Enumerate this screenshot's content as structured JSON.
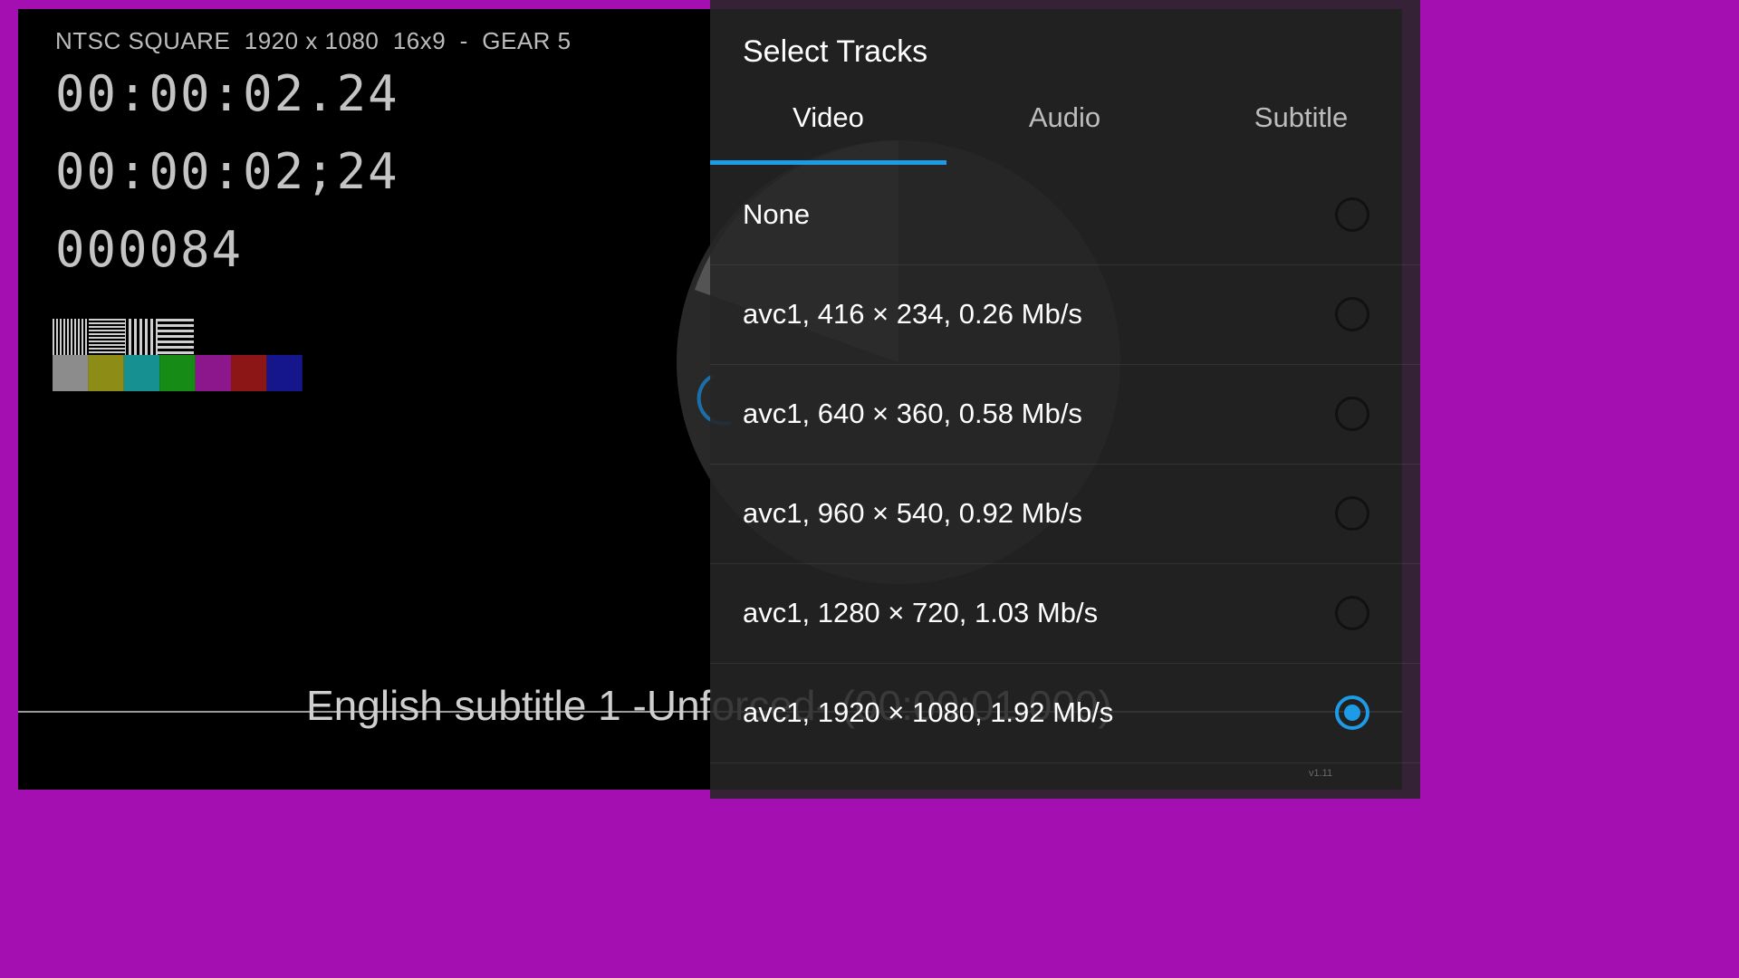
{
  "video": {
    "info_line": "NTSC SQUARE  1920 x 1080  16x9  -  GEAR 5",
    "timecodes": [
      "00:00:02.24",
      "00:00:02;24",
      "000084"
    ],
    "subtitle_text": "English subtitle 1 -Unforced- (00:00:01.000)",
    "color_bars": [
      "#8c8c8c",
      "#8c8c16",
      "#169090",
      "#168c16",
      "#8c168c",
      "#8c1616",
      "#16168c"
    ]
  },
  "dialog": {
    "title": "Select Tracks",
    "tabs": [
      {
        "label": "Video",
        "selected": true
      },
      {
        "label": "Audio",
        "selected": false
      },
      {
        "label": "Subtitle",
        "selected": false
      }
    ],
    "tracks": [
      {
        "label": "None",
        "selected": false
      },
      {
        "label": "avc1, 416 × 234, 0.26 Mb/s",
        "selected": false
      },
      {
        "label": "avc1, 640 × 360, 0.58 Mb/s",
        "selected": false
      },
      {
        "label": "avc1, 960 × 540, 0.92 Mb/s",
        "selected": false
      },
      {
        "label": "avc1, 1280 × 720, 1.03 Mb/s",
        "selected": false
      },
      {
        "label": "avc1, 1920 × 1080, 1.92 Mb/s",
        "selected": true
      }
    ],
    "version": "v1.11",
    "accent_color": "#1e9be6"
  }
}
